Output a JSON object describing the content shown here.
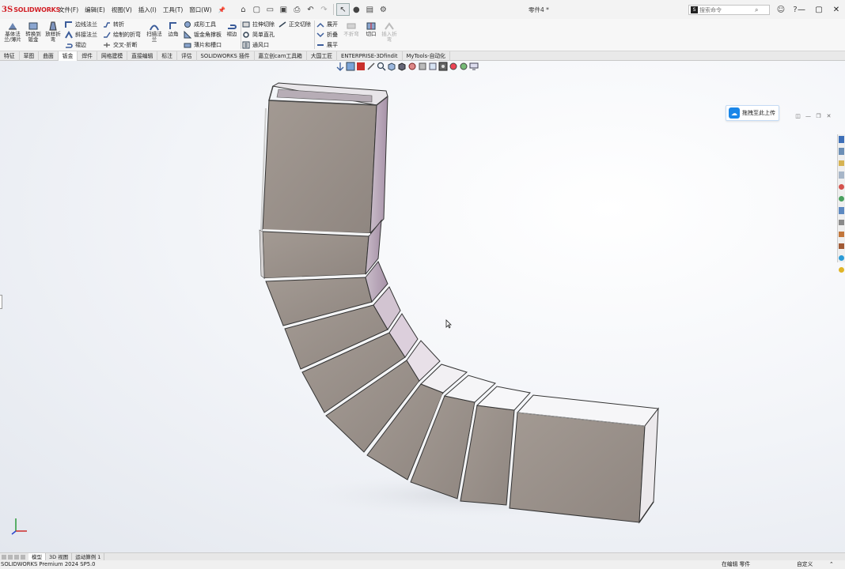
{
  "app": {
    "logo_prefix": "3S",
    "logo_name": "SOLIDWORKS",
    "document_title": "零件4 *"
  },
  "menu": [
    "文件(F)",
    "编辑(E)",
    "视图(V)",
    "插入(I)",
    "工具(T)",
    "窗口(W)"
  ],
  "search": {
    "placeholder": "搜索命令"
  },
  "ribbon": {
    "big_buttons": [
      "基体法兰/薄片",
      "转换到钣金",
      "放样折弯",
      "扫描法兰",
      "边角",
      "褶边",
      "展开",
      "切口"
    ],
    "edge_flange": "边线法兰",
    "miter_flange": "斜接法兰",
    "hem": "褶边",
    "jog": "转折",
    "sketched_bend": "绘制的折弯",
    "cross_break": "交叉-折断",
    "forming_tool": "成形工具",
    "gusset": "钣金角撑板",
    "tab_slot": "薄片和槽口",
    "extruded_cut": "拉伸切除",
    "simple_hole": "简单直孔",
    "vent": "通风口",
    "normal_cut": "正交切除",
    "unfold": "展开",
    "fold": "折叠",
    "flatten": "展平",
    "no_bends": "不折弯",
    "rip": "切口",
    "insert_bends": "插入折弯"
  },
  "tabs": [
    {
      "label": "特征",
      "active": false
    },
    {
      "label": "草图",
      "active": false
    },
    {
      "label": "曲面",
      "active": false
    },
    {
      "label": "钣金",
      "active": true
    },
    {
      "label": "焊件",
      "active": false
    },
    {
      "label": "网格建模",
      "active": false
    },
    {
      "label": "直接编辑",
      "active": false
    },
    {
      "label": "标注",
      "active": false
    },
    {
      "label": "评估",
      "active": false
    },
    {
      "label": "SOLIDWORKS 插件",
      "active": false
    },
    {
      "label": "嘉立创cam工具箱",
      "active": false
    },
    {
      "label": "大国工匠",
      "active": false
    },
    {
      "label": "ENTERPRISE-3Dfindit",
      "active": false
    },
    {
      "label": "MyTools-自动化",
      "active": false
    }
  ],
  "upload_button": "拖拽至此上传",
  "bottom_tabs": [
    {
      "label": "模型",
      "active": true
    },
    {
      "label": "3D 视图",
      "active": false
    },
    {
      "label": "运动算例 1",
      "active": false
    }
  ],
  "status": {
    "version": "SOLIDWORKS Premium 2024 SP5.0",
    "mode": "在编辑 零件",
    "custom": "自定义"
  },
  "colors": {
    "brand_red": "#d21f26",
    "model_face": "#9c948e",
    "model_inner": "#b5a0b4",
    "upload_blue": "#1a86e8"
  }
}
